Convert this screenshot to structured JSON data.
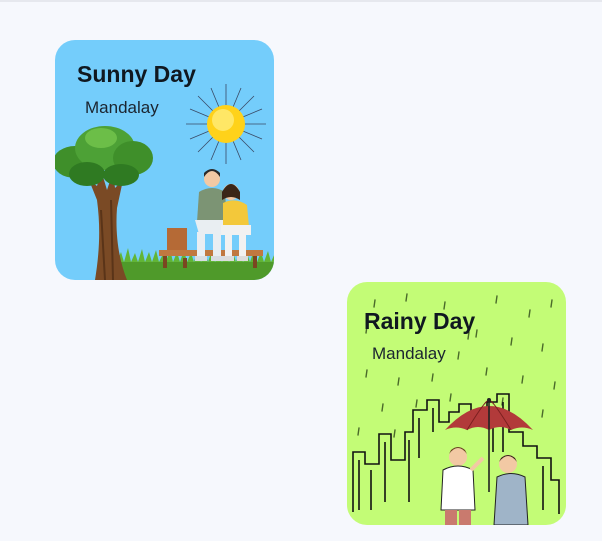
{
  "cards": [
    {
      "title": "Sunny Day",
      "location": "Mandalay",
      "background": "#74cdfb"
    },
    {
      "title": "Rainy Day",
      "location": "Mandalay",
      "background": "#c3fc76"
    }
  ],
  "icons": [
    "sun-icon",
    "tree-icon",
    "bench-couple-icon",
    "city-skyline-icon",
    "umbrella-icon",
    "rain-icon",
    "people-icon"
  ]
}
